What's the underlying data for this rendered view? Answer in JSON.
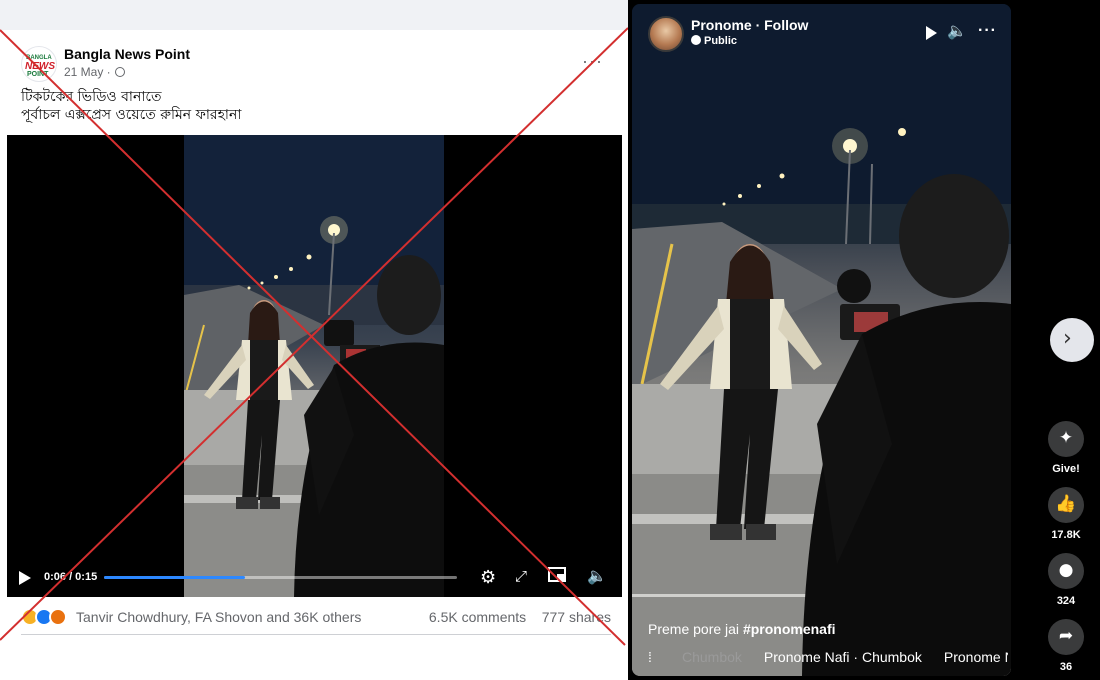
{
  "left_post": {
    "page_name": "Bangla News Point",
    "avatar_text": [
      "BANGLA",
      "NEWS",
      "POINT"
    ],
    "date": "21 May ·",
    "more_label": "···",
    "text_line1": "টিকটকের ভিডিও বানাতে",
    "text_line2": "পূর্বাচল এক্সপ্রেস ওয়েতে রুমিন ফারহানা",
    "video": {
      "current_time": "0:06",
      "duration": "0:15",
      "time_display": "0:06 / 0:15",
      "progress_fraction": 0.4
    },
    "reaction_names": "Tanvir Chowdhury, FA Shovon and 36K others",
    "comments": "6.5K comments",
    "shares": "777 shares"
  },
  "right_reel": {
    "name": "Pronome · Follow",
    "privacy": "Public",
    "caption_text": "Preme pore jai ",
    "caption_hashtag": "#pronomenafi",
    "audio_items": [
      "Chumbok",
      "Pronome Nafi · Chumbok",
      "Pronome Nafi · Chumbok"
    ],
    "actions": {
      "give_label": "Give!",
      "likes": "17.8K",
      "comments": "324",
      "shares": "36"
    }
  },
  "colors": {
    "cross": "#d32f2f",
    "facebook_blue": "#1877f2",
    "progress_blue": "#2d88ff"
  },
  "icons": [
    "play-icon",
    "settings-icon",
    "expand-icon",
    "pip-icon",
    "mute-icon",
    "globe-icon",
    "chevron-right-icon",
    "star-give-icon",
    "like-icon",
    "comment-icon",
    "share-icon",
    "more-icon"
  ]
}
